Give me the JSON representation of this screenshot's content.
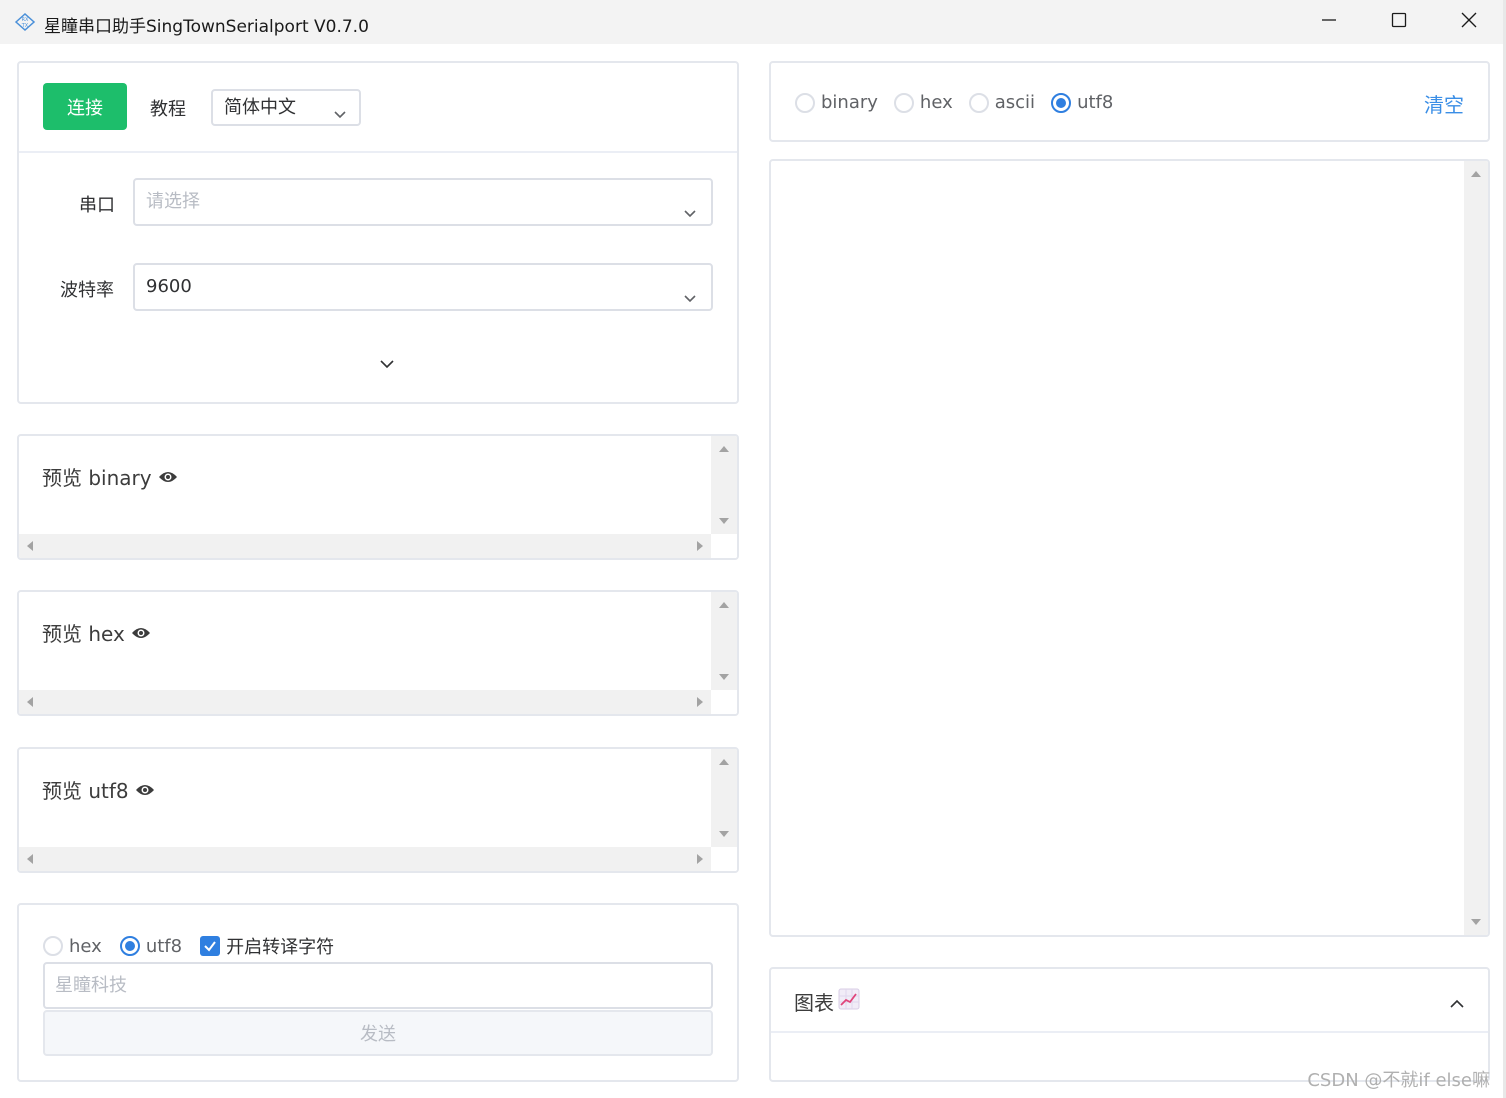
{
  "window": {
    "title": "星瞳串口助手SingTownSerialport V0.7.0",
    "app_icon": "rx-tx-icon",
    "controls": [
      "minimize-icon",
      "maximize-icon",
      "close-icon"
    ]
  },
  "connect_panel": {
    "connect_label": "连接",
    "tutorial_label": "教程",
    "language_value": "简体中文",
    "port_label": "串口",
    "port_placeholder": "请选择",
    "baud_label": "波特率",
    "baud_value": "9600"
  },
  "previews": [
    {
      "label": "预览 binary"
    },
    {
      "label": "预览 hex"
    },
    {
      "label": "预览 utf8"
    }
  ],
  "send_panel": {
    "radio_hex": "hex",
    "radio_utf8": "utf8",
    "selected": "utf8",
    "escape_label": "开启转译字符",
    "escape_checked": true,
    "input_placeholder": "星瞳科技",
    "send_label": "发送"
  },
  "receive_panel": {
    "formats": [
      "binary",
      "hex",
      "ascii",
      "utf8"
    ],
    "selected": "utf8",
    "clear_label": "清空"
  },
  "chart_panel": {
    "title": "图表"
  },
  "watermark": "CSDN @不就if else嘛",
  "colors": {
    "connect_green": "#1dbe6b",
    "accent_blue": "#2f7fe0",
    "link_blue": "#3a8ee6"
  }
}
